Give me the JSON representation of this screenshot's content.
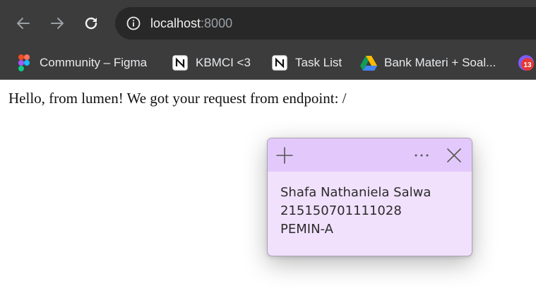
{
  "browser": {
    "url_host": "localhost",
    "url_port": ":8000"
  },
  "bookmarks": [
    {
      "label": "Community – Figma",
      "icon": "figma-icon"
    },
    {
      "label": "KBMCI <3",
      "icon": "notion-icon"
    },
    {
      "label": "Task List",
      "icon": "notion-icon"
    },
    {
      "label": "Bank Materi + Soal...",
      "icon": "google-drive-icon"
    },
    {
      "label": "",
      "icon": "calendar-icon",
      "badge": "13"
    }
  ],
  "page": {
    "message": "Hello, from lumen! We got your request from endpoint: /"
  },
  "sticky_note": {
    "lines": [
      "Shafa Nathaniela Salwa",
      "215150701111028",
      "PEMIN-A"
    ],
    "colors": {
      "header": "#e3c9fb",
      "body": "#f1e1fd"
    }
  }
}
